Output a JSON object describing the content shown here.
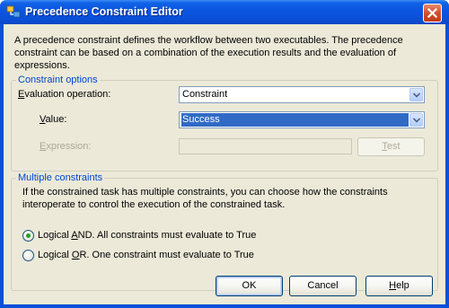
{
  "window": {
    "title": "Precedence Constraint Editor",
    "icon": "ssis-package-icon",
    "close_icon": "close-icon"
  },
  "description": "A precedence constraint defines the workflow between two executables. The precedence constraint can be based on a combination of the execution results and the evaluation of expressions.",
  "constraint_options": {
    "legend": "Constraint options",
    "evaluation_operation": {
      "label_prefix": "",
      "label_underline": "E",
      "label_rest": "valuation operation:",
      "value": "Constraint"
    },
    "value": {
      "label_underline": "V",
      "label_rest": "alue:",
      "value": "Success"
    },
    "expression": {
      "label_underline": "E",
      "label_rest": "xpression:",
      "value": ""
    },
    "test_button": {
      "label_underline": "T",
      "label_rest": "est"
    }
  },
  "multiple_constraints": {
    "legend": "Multiple constraints",
    "description": "If the constrained task has multiple constraints, you can choose how the constraints interoperate to control the execution of the constrained task.",
    "logical_and": {
      "prefix": "Logical ",
      "underline": "A",
      "rest": "ND. All constraints must evaluate to True",
      "selected": true
    },
    "logical_or": {
      "prefix": "Logical ",
      "underline": "O",
      "rest": "R. One constraint must evaluate to True",
      "selected": false
    }
  },
  "buttons": {
    "ok": "OK",
    "cancel": "Cancel",
    "help_underline": "H",
    "help_rest": "elp"
  },
  "colors": {
    "title_bar": "#0a55df",
    "accent_legend": "#0046d5",
    "selection": "#316ac5",
    "dialog_bg": "#ece9d8"
  }
}
